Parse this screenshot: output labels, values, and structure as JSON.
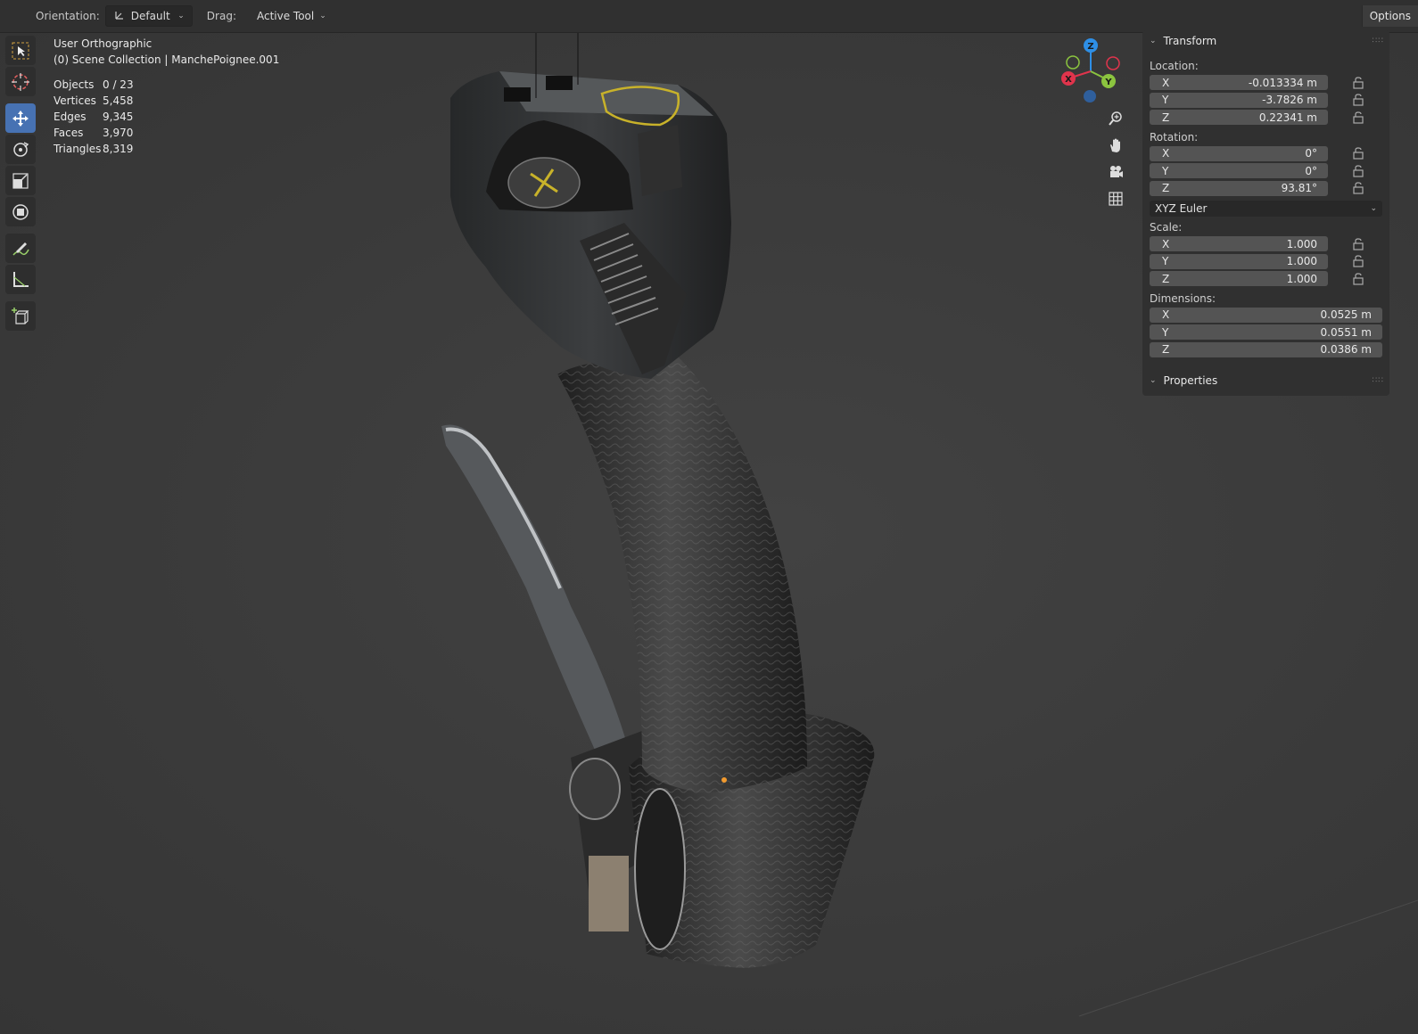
{
  "header": {
    "orientation_label": "Orientation:",
    "orientation_value": "Default",
    "drag_label": "Drag:",
    "drag_value": "Active Tool",
    "options_label": "Options"
  },
  "viewport": {
    "view_name": "User Orthographic",
    "collection": "(0) Scene Collection | ManchePoignee.001",
    "stats": [
      {
        "label": "Objects",
        "value": "0 / 23"
      },
      {
        "label": "Vertices",
        "value": "5,458"
      },
      {
        "label": "Edges",
        "value": "9,345"
      },
      {
        "label": "Faces",
        "value": "3,970"
      },
      {
        "label": "Triangles",
        "value": "8,319"
      }
    ]
  },
  "gizmo": {
    "x_label": "X",
    "y_label": "Y",
    "z_label": "Z"
  },
  "toolbar": {
    "tools": [
      "select-box-icon",
      "cursor-icon",
      "move-icon",
      "rotate-icon",
      "scale-icon",
      "transform-icon",
      "annotate-icon",
      "measure-icon",
      "add-cube-icon"
    ],
    "active": "move-icon"
  },
  "npanel": {
    "transform_title": "Transform",
    "location_label": "Location:",
    "location": [
      {
        "axis": "X",
        "value": "-0.013334 m"
      },
      {
        "axis": "Y",
        "value": "-3.7826 m"
      },
      {
        "axis": "Z",
        "value": "0.22341 m"
      }
    ],
    "rotation_label": "Rotation:",
    "rotation": [
      {
        "axis": "X",
        "value": "0°"
      },
      {
        "axis": "Y",
        "value": "0°"
      },
      {
        "axis": "Z",
        "value": "93.81°"
      }
    ],
    "rotation_mode": "XYZ Euler",
    "scale_label": "Scale:",
    "scale": [
      {
        "axis": "X",
        "value": "1.000"
      },
      {
        "axis": "Y",
        "value": "1.000"
      },
      {
        "axis": "Z",
        "value": "1.000"
      }
    ],
    "dimensions_label": "Dimensions:",
    "dimensions": [
      {
        "axis": "X",
        "value": "0.0525 m"
      },
      {
        "axis": "Y",
        "value": "0.0551 m"
      },
      {
        "axis": "Z",
        "value": "0.0386 m"
      }
    ],
    "properties_title": "Properties"
  },
  "colors": {
    "accent": "#4772b3",
    "axis_x": "#e0344c",
    "axis_y": "#8bc43f",
    "axis_z": "#2e8fe6"
  }
}
